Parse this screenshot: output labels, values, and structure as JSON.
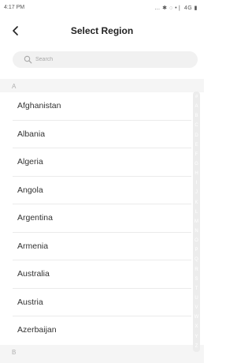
{
  "status_bar": {
    "time": "4:17 PM",
    "icons": "… ✱ ◌ •❘ 4G ▮"
  },
  "header": {
    "title": "Select Region",
    "back_icon": "chevron-left-icon"
  },
  "search": {
    "placeholder": "Search",
    "value": "",
    "icon": "search-icon"
  },
  "sections": [
    {
      "letter": "A",
      "items": [
        "Afghanistan",
        "Albania",
        "Algeria",
        "Angola",
        "Argentina",
        "Armenia",
        "Australia",
        "Austria",
        "Azerbaijan"
      ]
    },
    {
      "letter": "B",
      "items": []
    }
  ],
  "alpha_index": [
    "#",
    "A",
    "B",
    "C",
    "D",
    "E",
    "F",
    "G",
    "H",
    "I",
    "J",
    "K",
    "L",
    "M",
    "N",
    "O",
    "P",
    "Q",
    "R",
    "S",
    "T",
    "U",
    "V",
    "W",
    "X",
    "Y",
    "Z"
  ],
  "colors": {
    "list_background": "#f5f5f5",
    "search_background": "#f1f1f1",
    "index_background": "#ececec",
    "section_letter": "#b0b0b0"
  }
}
